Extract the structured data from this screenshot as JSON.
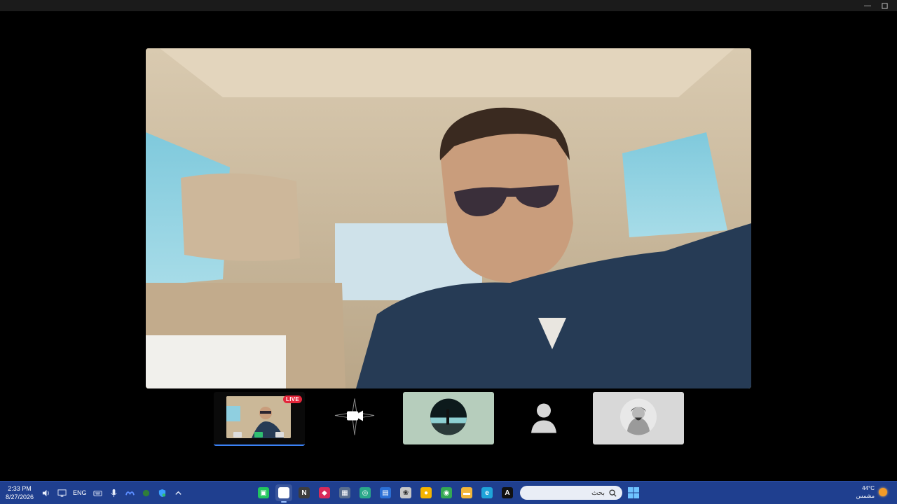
{
  "window": {
    "controls": {
      "minimize": "—",
      "maximize": "□"
    }
  },
  "stream": {
    "live_label": "LIVE"
  },
  "taskbar": {
    "time": "2:33 PM",
    "date": "8/27/2026",
    "language": "ENG",
    "search_placeholder": "بحث",
    "weather_temp": "44°C",
    "weather_desc": "مشمس",
    "apps": [
      {
        "name": "app-tile-1",
        "color": "#22c55e",
        "glyph": "▣"
      },
      {
        "name": "app-tile-2",
        "color": "#ffffff",
        "glyph": ""
      },
      {
        "name": "app-tile-3",
        "color": "#3d3d3d",
        "glyph": "N"
      },
      {
        "name": "app-tile-4",
        "color": "#d92b5a",
        "glyph": "◆"
      },
      {
        "name": "app-tile-5",
        "color": "#5a6f8f",
        "glyph": "▦"
      },
      {
        "name": "app-tile-6",
        "color": "#2aa88a",
        "glyph": "◎"
      },
      {
        "name": "app-tile-7",
        "color": "#2b6fd6",
        "glyph": "▤"
      },
      {
        "name": "app-tile-8",
        "color": "#c7c7c7",
        "glyph": "❀"
      },
      {
        "name": "app-tile-9",
        "color": "#f4b400",
        "glyph": "●"
      },
      {
        "name": "app-tile-10",
        "color": "#34a853",
        "glyph": "◉"
      },
      {
        "name": "app-tile-11",
        "color": "#f2b63a",
        "glyph": "▬"
      },
      {
        "name": "app-tile-12",
        "color": "#1fa4d9",
        "glyph": "e"
      },
      {
        "name": "app-tile-13",
        "color": "#111111",
        "glyph": "A"
      }
    ]
  },
  "colors": {
    "taskbar_bg": "#1f3f8f",
    "live_badge": "#e3263b",
    "avatar_tile": "#b6cdbc",
    "king_tile": "#d8d8d8"
  }
}
